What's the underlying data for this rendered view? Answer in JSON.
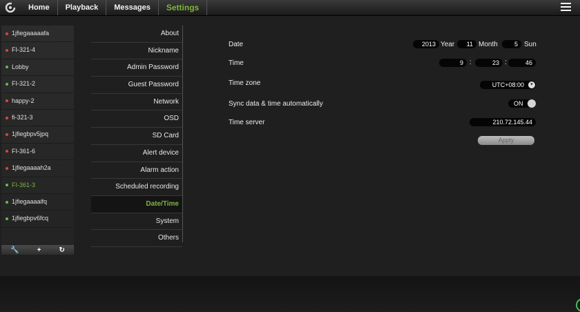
{
  "nav": {
    "items": [
      {
        "label": "Home"
      },
      {
        "label": "Playback"
      },
      {
        "label": "Messages"
      },
      {
        "label": "Settings"
      }
    ],
    "active_color": "#7fb63a"
  },
  "devices": [
    {
      "name": "1jfiegaaaaafa",
      "status": "offline"
    },
    {
      "name": "FI-321-4",
      "status": "offline"
    },
    {
      "name": "Lobby",
      "status": "online"
    },
    {
      "name": "FI-321-2",
      "status": "online"
    },
    {
      "name": "happy-2",
      "status": "offline"
    },
    {
      "name": "fi-321-3",
      "status": "offline"
    },
    {
      "name": "1jfiegbpv5jpq",
      "status": "offline"
    },
    {
      "name": "FI-361-6",
      "status": "offline"
    },
    {
      "name": "1jfiegaaaah2a",
      "status": "offline"
    },
    {
      "name": "FI-361-3",
      "status": "online"
    },
    {
      "name": "1jfiegaaaaifq",
      "status": "online"
    },
    {
      "name": "1jfiegbpv6fcq",
      "status": "online"
    }
  ],
  "status_colors": {
    "online": "#5cc24a",
    "offline": "#e0443c"
  },
  "device_toolbar": {
    "icons": [
      "wrench-icon",
      "plus-icon",
      "refresh-icon"
    ],
    "glyphs": [
      "🔧",
      "+",
      "↻"
    ]
  },
  "settings_menu": [
    {
      "label": "About"
    },
    {
      "label": "Nickname"
    },
    {
      "label": "Admin Password"
    },
    {
      "label": "Guest Password"
    },
    {
      "label": "Network"
    },
    {
      "label": "OSD"
    },
    {
      "label": "SD Card"
    },
    {
      "label": "Alert device"
    },
    {
      "label": "Alarm action"
    },
    {
      "label": "Scheduled recording"
    },
    {
      "label": "Date/Time"
    },
    {
      "label": "System"
    },
    {
      "label": "Others"
    }
  ],
  "datetime": {
    "date_label": "Date",
    "year": "2013",
    "year_unit": "Year",
    "month": "11",
    "month_unit": "Month",
    "weekday_num": "5",
    "weekday": "Sun",
    "time_label": "Time",
    "hour": "9",
    "minute": "23",
    "second": "46",
    "separator": ":",
    "timezone_label": "Time zone",
    "timezone": "UTC+08:00",
    "sync_label": "Sync data & time automatically",
    "sync_value": "ON",
    "server_label": "Time server",
    "server": "210.72.145.44",
    "apply_label": "Apply"
  }
}
